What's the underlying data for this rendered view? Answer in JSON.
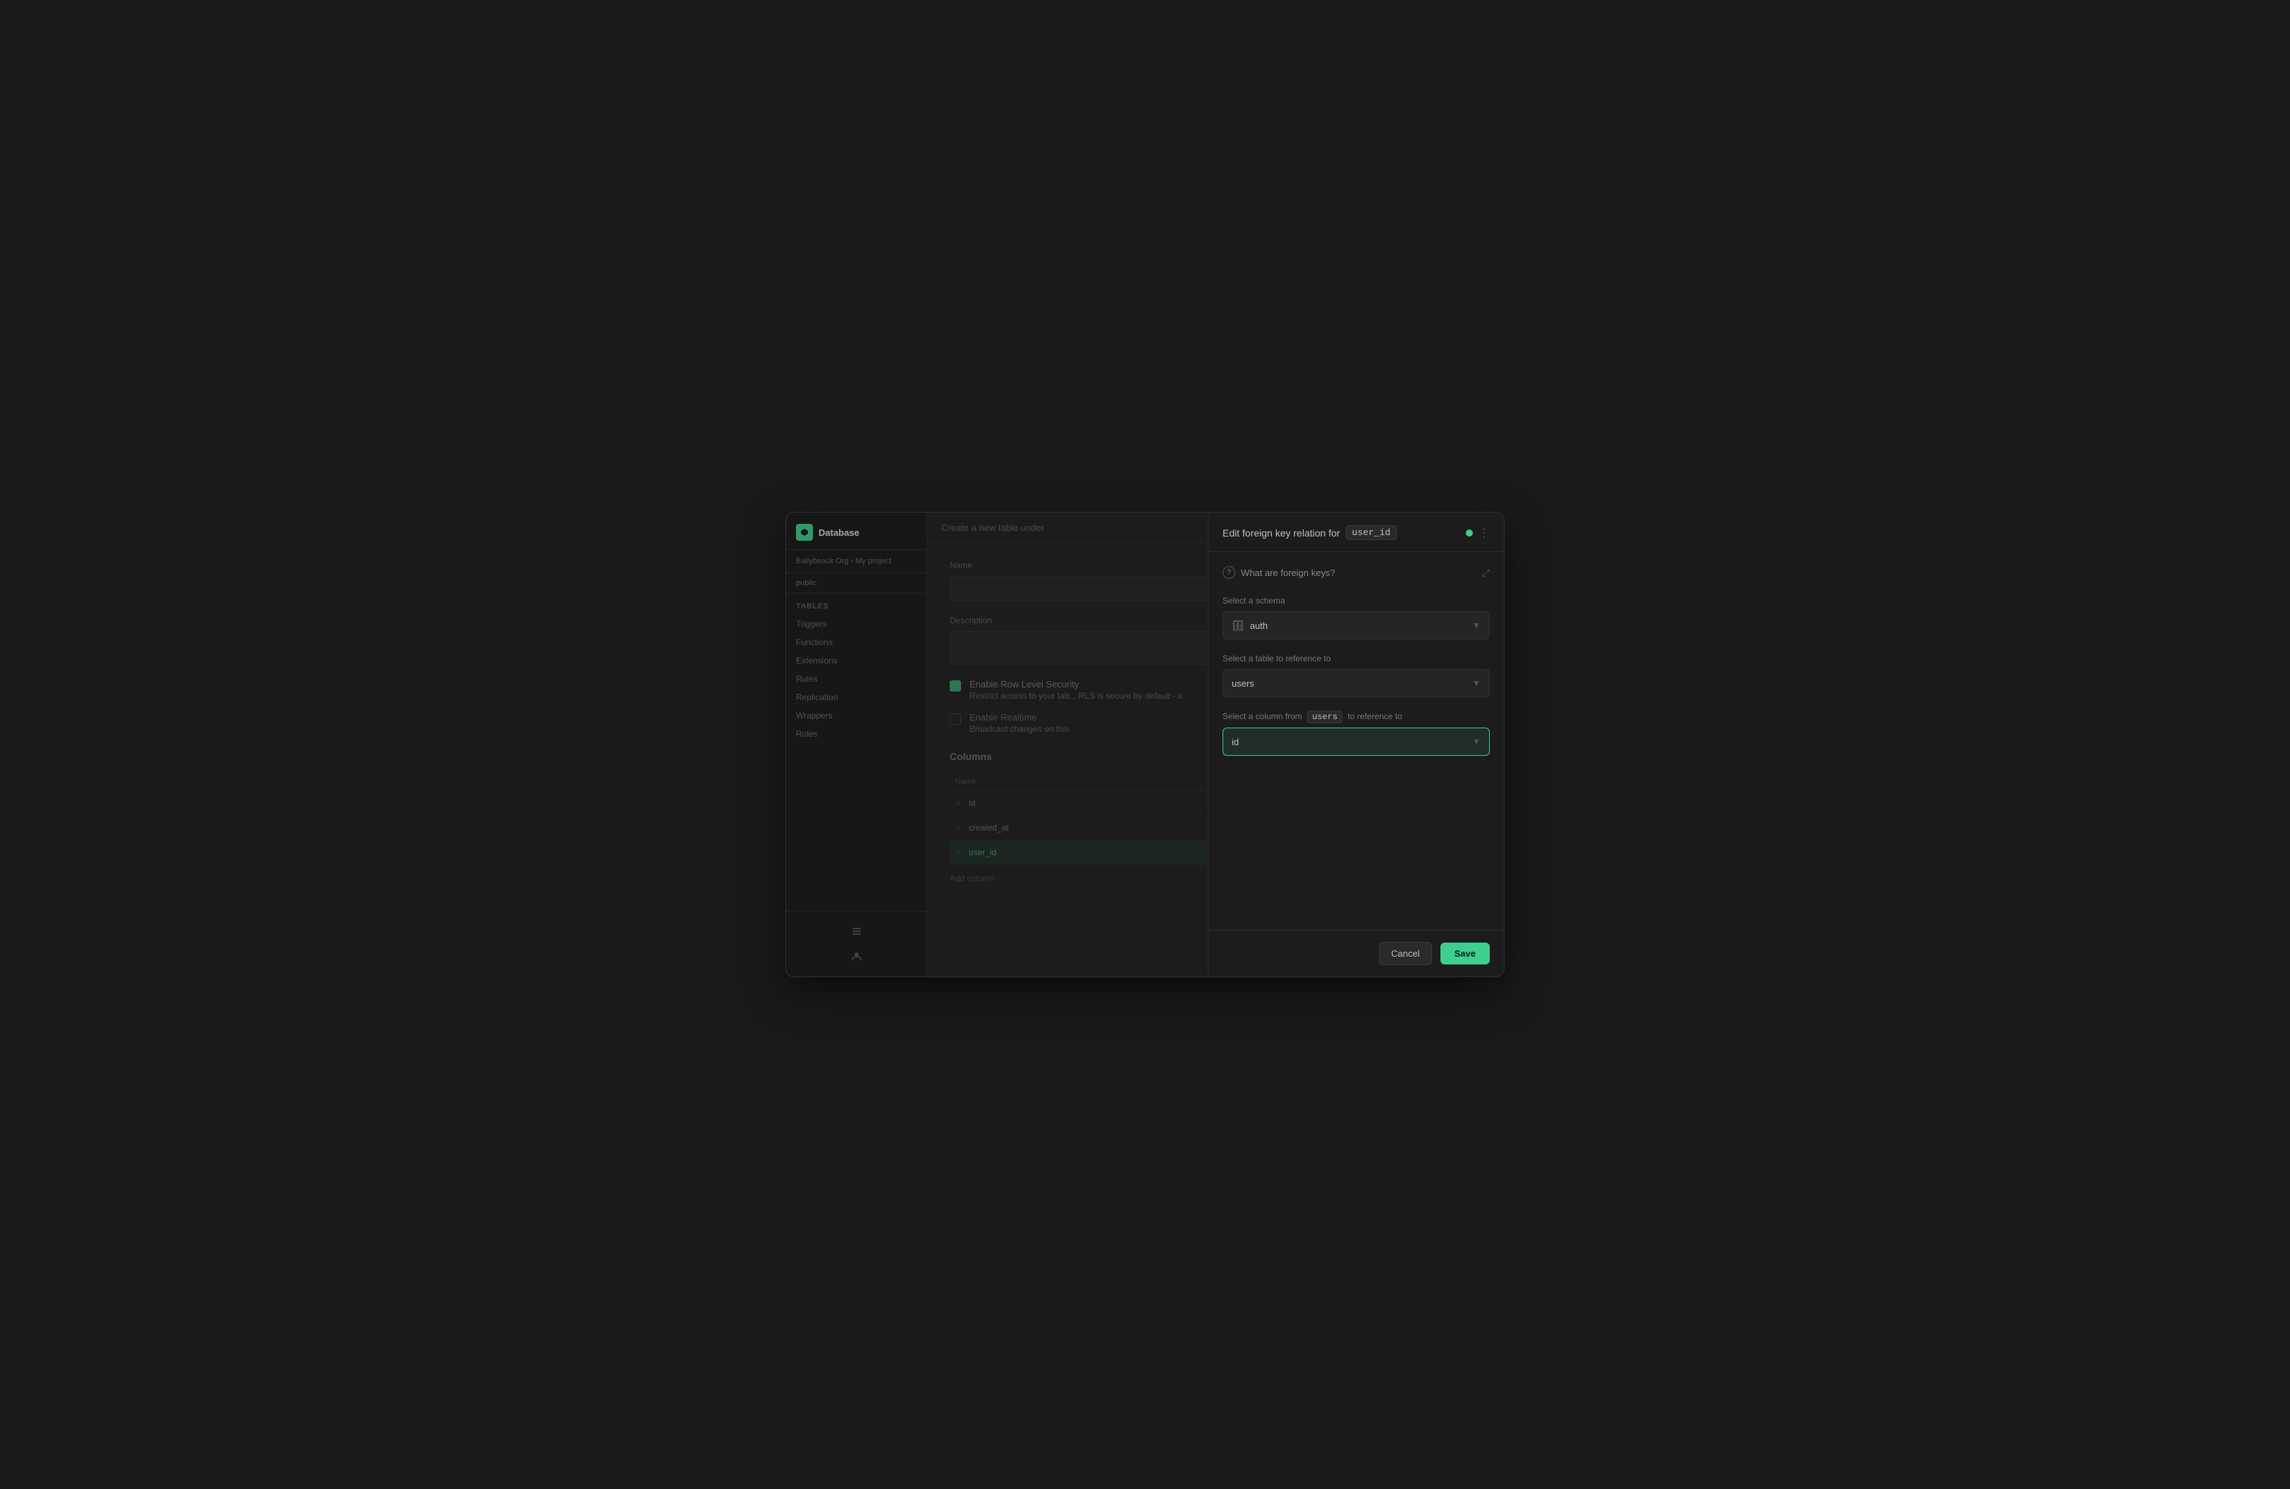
{
  "app": {
    "title": "Database",
    "org": "Ballybeack Org",
    "project": "My project",
    "schema": "public"
  },
  "sidebar": {
    "section_title": "Tables",
    "items": [
      {
        "label": "Triggers"
      },
      {
        "label": "Functions"
      },
      {
        "label": "Extensions"
      },
      {
        "label": "Rules"
      },
      {
        "label": "Replication"
      },
      {
        "label": "Wrappers"
      },
      {
        "label": "Roles"
      }
    ]
  },
  "main": {
    "header_title": "Create a new table under",
    "form": {
      "name_label": "Name",
      "description_label": "Description",
      "enable_rls_label": "Enable Row Level Security",
      "enable_rls_desc": "Restrict access to your tab... RLS is secure by default - a",
      "enable_realtime_label": "Enable Realtime",
      "enable_realtime_desc": "Broadcast changes on this"
    },
    "columns": {
      "section_label": "Columns",
      "header_name": "Name",
      "rows": [
        {
          "name": "id"
        },
        {
          "name": "created_at"
        },
        {
          "name": "user_id"
        }
      ],
      "add_button": "Add column"
    }
  },
  "panel": {
    "title_prefix": "Edit foreign key relation for",
    "title_field": "user_id",
    "help_text": "What are foreign keys?",
    "schema_label": "Select a schema",
    "schema_value": "auth",
    "table_label": "Select a table to reference to",
    "table_value": "users",
    "column_label_prefix": "Select a column from",
    "column_label_table": "users",
    "column_label_suffix": "to reference to",
    "column_value": "id",
    "cancel_button": "Cancel",
    "save_button": "Save"
  }
}
